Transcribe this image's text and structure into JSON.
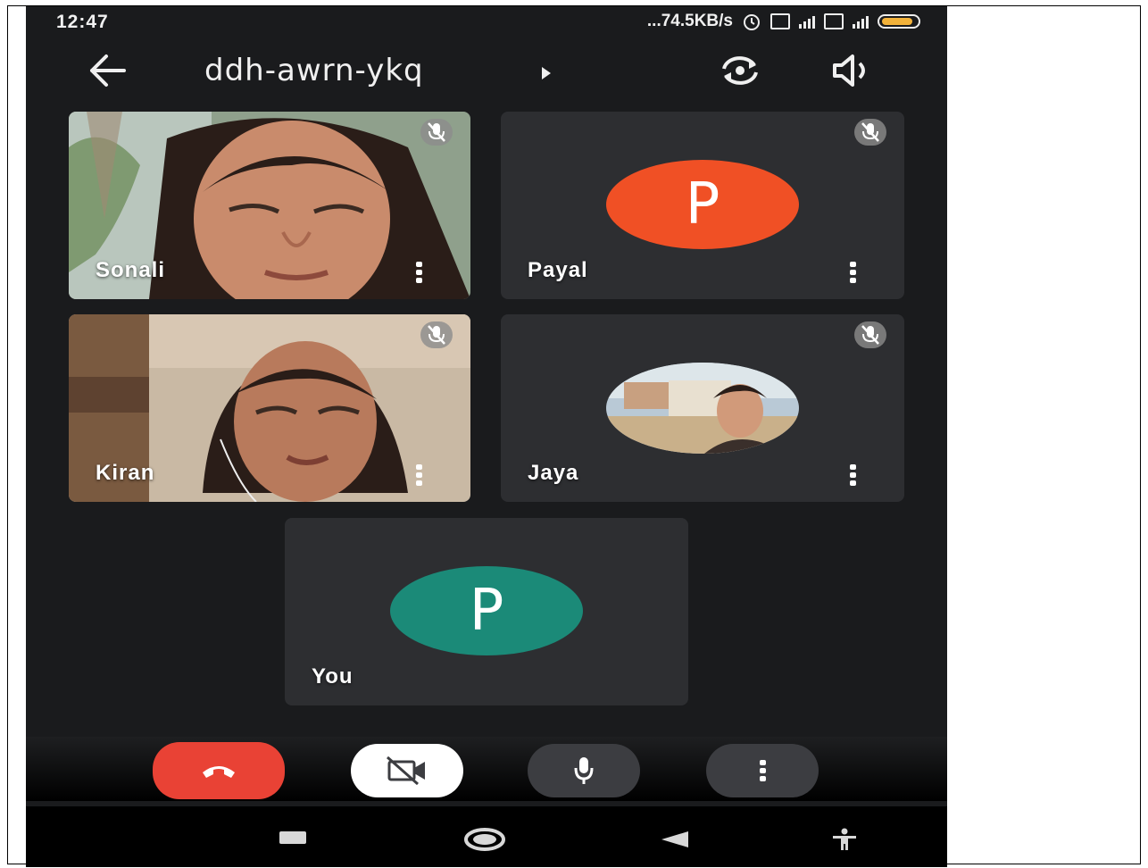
{
  "status_bar": {
    "time": "12:47",
    "network_speed": "...74.5KB/s"
  },
  "header": {
    "meeting_code": "ddh-awrn-ykq"
  },
  "participants": [
    {
      "name": "Sonali",
      "muted": true,
      "video": "camera"
    },
    {
      "name": "Payal",
      "muted": true,
      "initial": "P",
      "avatar_color": "#f05025"
    },
    {
      "name": "Kiran",
      "muted": true,
      "video": "camera"
    },
    {
      "name": "Jaya",
      "muted": true,
      "avatar": "profile-photo"
    }
  ],
  "self_tile": {
    "name": "You",
    "initial": "P",
    "avatar_color": "#1b8a78"
  },
  "controls": {
    "end_call": {
      "icon": "phone-hangup-icon",
      "color": "#e94235"
    },
    "camera": {
      "icon": "video-off-icon",
      "color": "#ffffff"
    },
    "microphone": {
      "icon": "mic-icon",
      "color": "#3c3d41"
    },
    "more": {
      "icon": "more-vert-icon",
      "color": "#3c3d41"
    }
  },
  "navigation": [
    "square-nav-icon",
    "circle-home-icon",
    "triangle-back-icon",
    "accessibility-icon"
  ]
}
